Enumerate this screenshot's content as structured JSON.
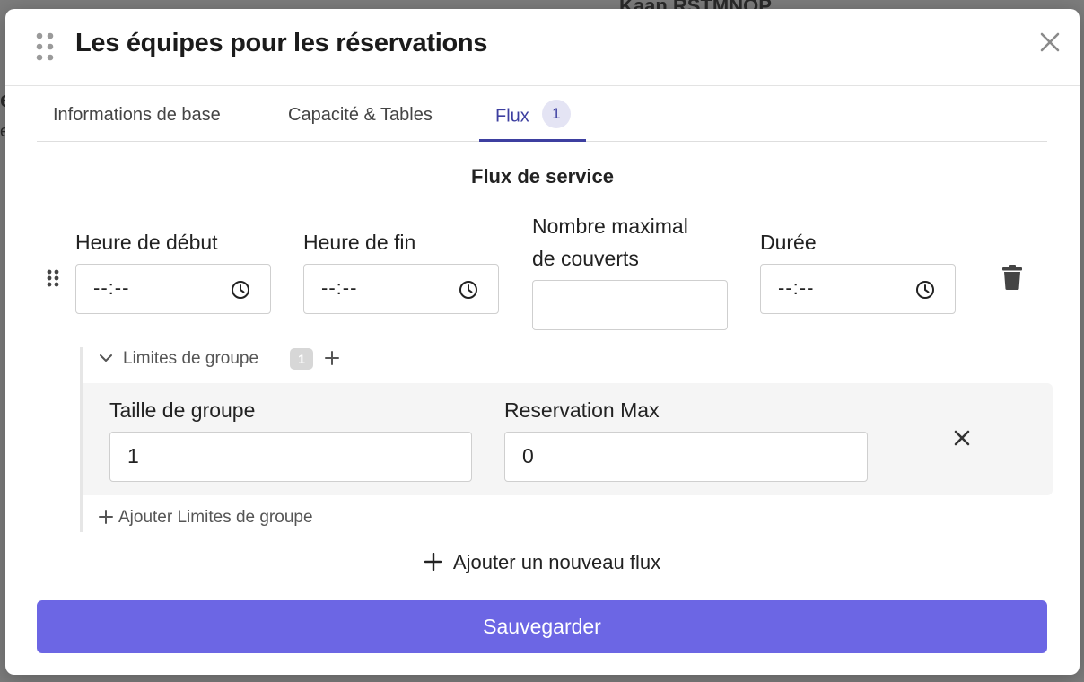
{
  "background": {
    "header_fragment": "Kaan RSTMNOP",
    "fragment_1": "e",
    "fragment_2": "e"
  },
  "modal": {
    "title": "Les équipes pour les réservations",
    "tabs": [
      {
        "label": "Informations de base",
        "active": false
      },
      {
        "label": "Capacité & Tables",
        "active": false
      },
      {
        "label": "Flux",
        "active": true,
        "badge": "1"
      }
    ]
  },
  "flux": {
    "section_title": "Flux de service",
    "fields": {
      "start_label": "Heure de début",
      "start_value": "--:--",
      "end_label": "Heure de fin",
      "end_value": "--:--",
      "max_covers_label_line1": "Nombre maximal",
      "max_covers_label_line2": "de couverts",
      "max_covers_value": "",
      "duration_label": "Durée",
      "duration_value": "--:--"
    },
    "group_limits": {
      "label": "Limites de groupe",
      "count": "1",
      "size_label": "Taille de groupe",
      "size_value": "1",
      "max_label": "Reservation Max",
      "max_value": "0",
      "add_label": "Ajouter Limites de groupe"
    },
    "add_flux_label": "Ajouter un nouveau flux"
  },
  "save_label": "Sauvegarder",
  "colors": {
    "accent": "#3d3fa0",
    "save_button": "#6c66e4"
  },
  "icons": [
    "drag-handle-icon",
    "close-icon",
    "clock-icon",
    "trash-icon",
    "chevron-down-icon",
    "plus-icon"
  ]
}
